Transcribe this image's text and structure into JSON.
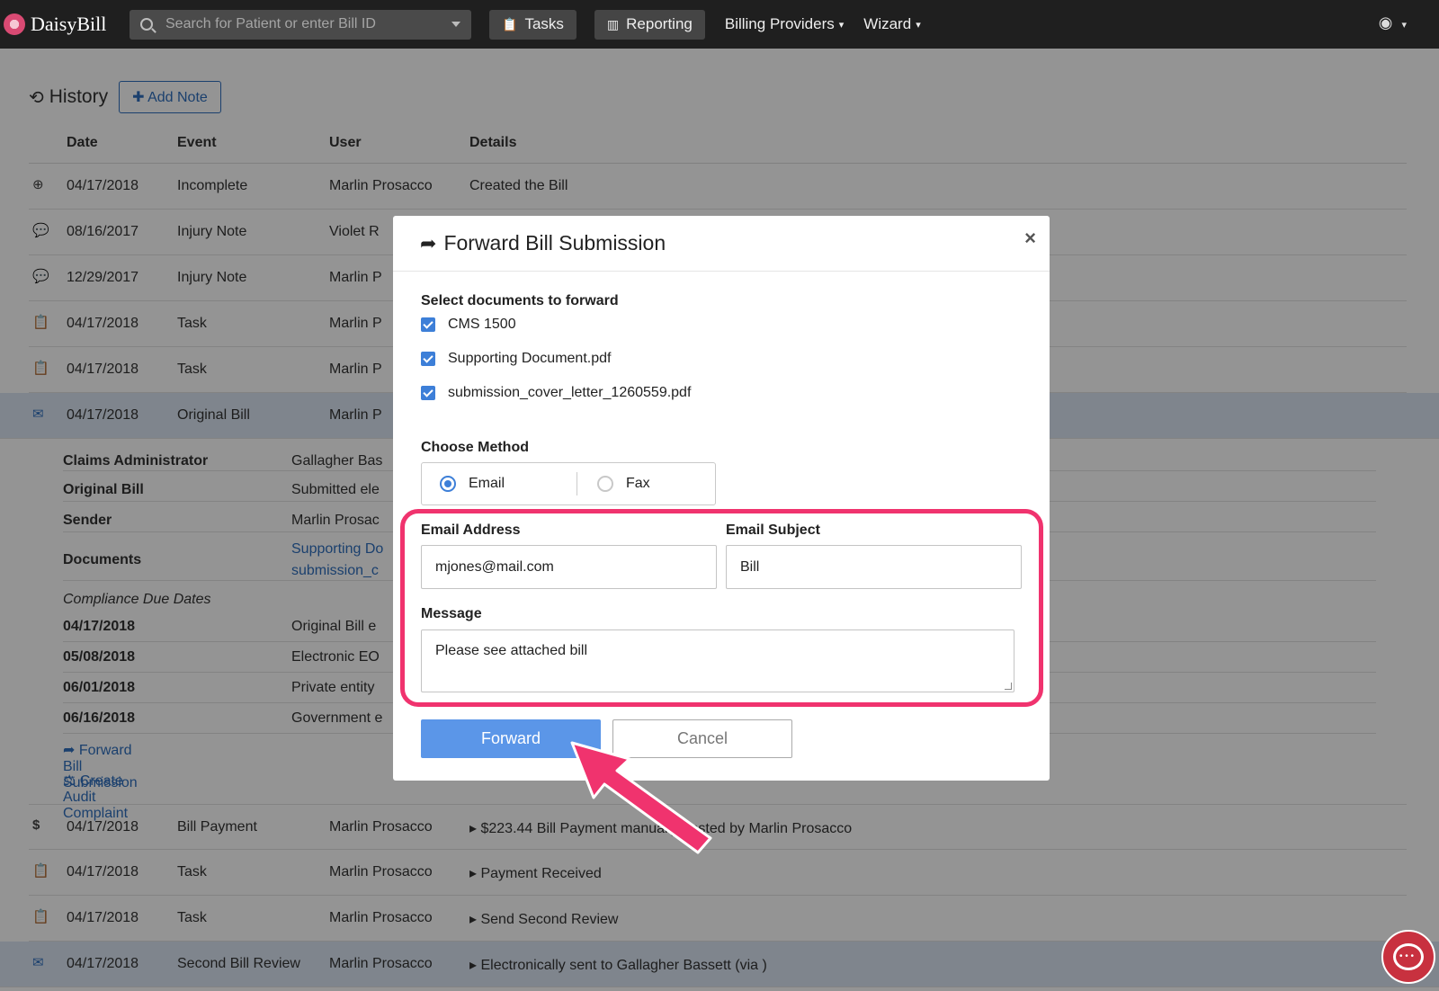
{
  "nav": {
    "logo": "DaisyBill",
    "search_placeholder": "Search for Patient or enter Bill ID",
    "tasks": "Tasks",
    "reporting": "Reporting",
    "billing_providers": "Billing Providers",
    "wizard": "Wizard"
  },
  "history": {
    "title": "History",
    "add_note": "Add Note",
    "columns": [
      "Date",
      "Event",
      "User",
      "Details"
    ],
    "rows": [
      {
        "icon": "plus-circle-icon",
        "date": "04/17/2018",
        "event": "Incomplete",
        "user": "Marlin Prosacco",
        "details": "Created the Bill"
      },
      {
        "icon": "comment-icon",
        "date": "08/16/2017",
        "event": "Injury Note",
        "user": "Violet R",
        "details": ""
      },
      {
        "icon": "comment-icon",
        "date": "12/29/2017",
        "event": "Injury Note",
        "user": "Marlin P",
        "details": ""
      },
      {
        "icon": "clipboard-icon",
        "date": "04/17/2018",
        "event": "Task",
        "user": "Marlin P",
        "details": ""
      },
      {
        "icon": "clipboard-icon",
        "date": "04/17/2018",
        "event": "Task",
        "user": "Marlin P",
        "details": ""
      },
      {
        "icon": "envelope-icon",
        "date": "04/17/2018",
        "event": "Original Bill",
        "user": "Marlin P",
        "details": ""
      }
    ],
    "original_bill_details": [
      {
        "label": "Claims Administrator",
        "value": "Gallagher Bas"
      },
      {
        "label": "Original Bill",
        "value": "Submitted ele"
      },
      {
        "label": "Sender",
        "value": "Marlin Prosac"
      },
      {
        "label": "Documents",
        "value": "Supporting Do",
        "value2": "submission_c"
      }
    ],
    "compliance_title": "Compliance Due Dates",
    "compliance": [
      {
        "date": "04/17/2018",
        "value": "Original Bill e"
      },
      {
        "date": "05/08/2018",
        "value": "Electronic EO"
      },
      {
        "date": "06/01/2018",
        "value": "Private entity"
      },
      {
        "date": "06/16/2018",
        "value": "Government e"
      }
    ],
    "forward_link": "Forward Bill Submission",
    "audit_link": "Create Audit Complaint",
    "rows_after": [
      {
        "icon": "dollar-icon",
        "date": "04/17/2018",
        "event": "Bill Payment",
        "user": "Marlin Prosacco",
        "details": "$223.44 Bill Payment manually posted by Marlin Prosacco"
      },
      {
        "icon": "clipboard-icon",
        "date": "04/17/2018",
        "event": "Task",
        "user": "Marlin Prosacco",
        "details": "Payment Received"
      },
      {
        "icon": "clipboard-icon",
        "date": "04/17/2018",
        "event": "Task",
        "user": "Marlin Prosacco",
        "details": "Send Second Review"
      },
      {
        "icon": "envelope-icon",
        "date": "04/17/2018",
        "event": "Second Bill Review",
        "user": "Marlin Prosacco",
        "details": "Electronically sent to Gallagher Bassett (via )"
      }
    ]
  },
  "modal": {
    "title": "Forward Bill Submission",
    "close": "×",
    "select_docs_label": "Select documents to forward",
    "documents": [
      "CMS 1500",
      "Supporting Document.pdf",
      "submission_cover_letter_1260559.pdf"
    ],
    "method_label": "Choose Method",
    "method_email": "Email",
    "method_fax": "Fax",
    "email_address_label": "Email Address",
    "email_address_value": "mjones@mail.com",
    "email_subject_label": "Email Subject",
    "email_subject_value": "Bill",
    "message_label": "Message",
    "message_value": "Please see attached bill",
    "forward_button": "Forward",
    "cancel_button": "Cancel"
  },
  "colors": {
    "nav_bg": "#1f1f1f",
    "accent_blue": "#3d7fd8",
    "highlight_pink": "#f0336e",
    "chat_red": "#c8313f"
  }
}
